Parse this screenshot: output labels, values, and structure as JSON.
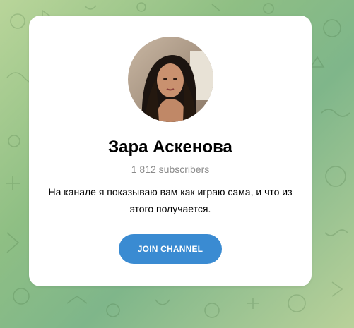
{
  "channel": {
    "name": "Зара Аскенова",
    "subscribers": "1 812 subscribers",
    "description": "На канале я показываю вам как играю сама, и что из этого получается.",
    "join_label": "JOIN CHANNEL"
  },
  "colors": {
    "button": "#3a8bd2",
    "subscribers_text": "#8a8a8a"
  },
  "icons": {
    "avatar": "avatar-photo",
    "background": "doodle-pattern"
  }
}
